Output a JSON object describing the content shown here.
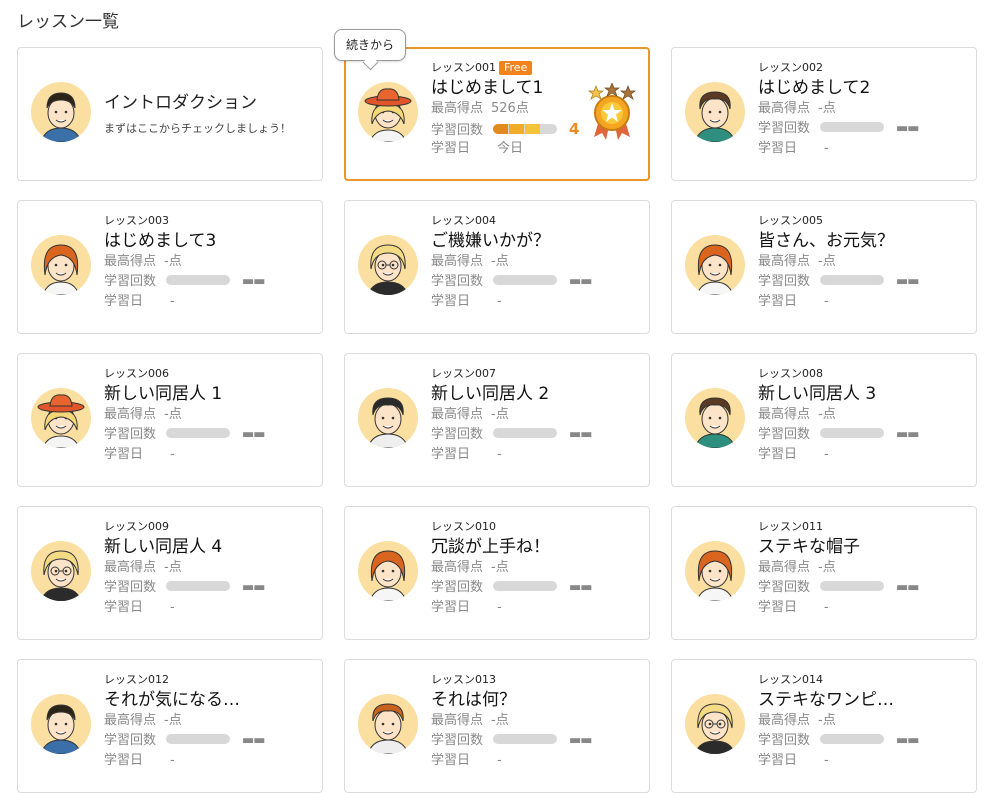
{
  "page": {
    "title": "レッスン一覧"
  },
  "labels": {
    "score": "最高得点",
    "count": "学習回数",
    "date": "学習日",
    "empty_dash": "▬▬"
  },
  "tooltip": {
    "resume": "続きから"
  },
  "intro": {
    "title": "イントロダクション",
    "subtitle": "まずはここからチェックしましょう！",
    "character": "man-black-hair"
  },
  "lessons": [
    {
      "no": "レッスン001",
      "badge": "Free",
      "title": "はじめまして1",
      "score": "526点",
      "count": "4",
      "progress": 0.75,
      "date": "今日",
      "character": "cowgirl",
      "medal": "gold-medal-3-stars"
    },
    {
      "no": "レッスン002",
      "title": "はじめまして2",
      "score": "-点",
      "date": "-",
      "character": "man-tan-curly"
    },
    {
      "no": "レッスン003",
      "title": "はじめまして3",
      "score": "-点",
      "date": "-",
      "character": "woman-orange-hair"
    },
    {
      "no": "レッスン004",
      "title": "ご機嫌いかが？",
      "score": "-点",
      "date": "-",
      "character": "blonde-glasses"
    },
    {
      "no": "レッスン005",
      "title": "皆さん、お元気？",
      "score": "-点",
      "date": "-",
      "character": "woman-orange-hair"
    },
    {
      "no": "レッスン006",
      "title": "新しい同居人 1",
      "score": "-点",
      "date": "-",
      "character": "cowgirl"
    },
    {
      "no": "レッスン007",
      "title": "新しい同居人 2",
      "score": "-点",
      "date": "-",
      "character": "man-dark-hair"
    },
    {
      "no": "レッスン008",
      "title": "新しい同居人 3",
      "score": "-点",
      "date": "-",
      "character": "man-tan-curly"
    },
    {
      "no": "レッスン009",
      "title": "新しい同居人 4",
      "score": "-点",
      "date": "-",
      "character": "blonde-glasses"
    },
    {
      "no": "レッスン010",
      "title": "冗談が上手ね！",
      "score": "-点",
      "date": "-",
      "character": "woman-orange-hair"
    },
    {
      "no": "レッスン011",
      "title": "ステキな帽子",
      "score": "-点",
      "date": "-",
      "character": "woman-orange-hair"
    },
    {
      "no": "レッスン012",
      "title": "それが気になる…",
      "score": "-点",
      "date": "-",
      "character": "man-black-hair"
    },
    {
      "no": "レッスン013",
      "title": "それは何？",
      "score": "-点",
      "date": "-",
      "character": "man-orange-hair"
    },
    {
      "no": "レッスン014",
      "title": "ステキなワンピ…",
      "score": "-点",
      "date": "-",
      "character": "blonde-glasses"
    }
  ],
  "colors": {
    "accent": "#e9962a",
    "avatar_bg": "#fbdfa0",
    "count_text": "#ea8a20"
  }
}
